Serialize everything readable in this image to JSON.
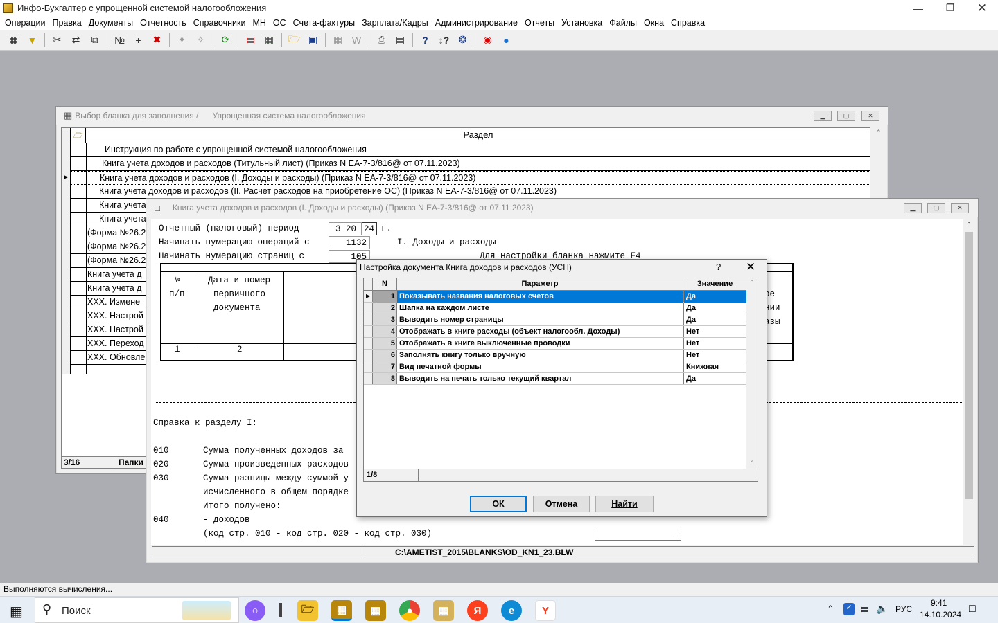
{
  "app": {
    "title": "Инфо-Бухгалтер с упрощенной системой налогообложения"
  },
  "menu": [
    "Операции",
    "Правка",
    "Документы",
    "Отчетность",
    "Справочники",
    "МН",
    "ОС",
    "Счета-фактуры",
    "Зарплата/Кадры",
    "Администрирование",
    "Отчеты",
    "Установка",
    "Файлы",
    "Окна",
    "Справка"
  ],
  "window1": {
    "title_part1": "Выбор бланка для заполнения /",
    "title_part2": "Упрощенная система налогообложения",
    "column_header": "Раздел",
    "rows": [
      "Инструкция по работе с упрощенной системой налогообложения",
      "Книга учета доходов и расходов (Титульный лист) (Приказ N ЕА-7-3/816@ от 07.11.2023)",
      "Книга учета доходов и расходов (I. Доходы и расходы) (Приказ N ЕА-7-3/816@ от 07.11.2023)",
      "Книга учета доходов и расходов (II. Расчет расходов на приобретение ОС) (Приказ N ЕА-7-3/816@ от 07.11.2023)",
      "Книга учета",
      "Книга учета",
      "(Форма №26.2",
      "(Форма №26.2",
      "(Форма №26.2",
      "Книга учета д",
      "Книга учета д",
      "XXX.  Измене",
      "XXX.  Настрой",
      "XXX.  Настрой",
      "XXX.  Переход",
      "XXX. Обновлен"
    ],
    "status_count": "3/16",
    "status_folder": "Папки"
  },
  "window2": {
    "title": "Книга учета доходов и расходов (I. Доходы и расходы) (Приказ N ЕА-7-3/816@ от 07.11.2023)",
    "period_label": "Отчетный (налоговый) период",
    "period_q": "3",
    "period_y1": "20",
    "period_y2": "24",
    "period_suffix": "г.",
    "ops_label": "Начинать нумерацию операций с",
    "ops_value": "1132",
    "section_title": "I. Доходы и расходы",
    "pages_label": "Начинать нумерацию страниц с",
    "pages_value": "105",
    "f4_hint": "Для настройки бланка нажмите F4",
    "table_h1a": "№",
    "table_h1b": "п/п",
    "table_h2a": "Дата и номер",
    "table_h2b": "первичного",
    "table_h2c": "документа",
    "table_frag1": "ре",
    "table_frag2": "нии",
    "table_frag3": "азы",
    "table_num1": "1",
    "table_num2": "2",
    "ref_title": "Справка к разделу I:",
    "ref_010_code": "010",
    "ref_010_text": "Сумма полученных доходов за",
    "ref_020_code": "020",
    "ref_020_text": "Сумма произведенных расходов",
    "ref_030_code": "030",
    "ref_030_text": "Сумма разницы между суммой у",
    "ref_030b_text": "исчисленного в общем порядке",
    "ref_total": "Итого получено:",
    "ref_040_code": "040",
    "ref_040_text": "- доходов",
    "ref_040b_text": "(код стр. 010 - код стр. 020 - код стр. 030)",
    "input_dash": "-",
    "path": "C:\\AMETIST_2015\\BLANKS\\OD_KN1_23.BLW"
  },
  "dialog": {
    "title": "Настройка документа Книга доходов и расходов (УСН)",
    "help": "?",
    "col_n": "N",
    "col_param": "Параметр",
    "col_value": "Значение",
    "rows": [
      {
        "n": "1",
        "param": "Показывать названия налоговых счетов",
        "value": "Да"
      },
      {
        "n": "2",
        "param": "Шапка на каждом листе",
        "value": "Да"
      },
      {
        "n": "3",
        "param": "Выводить номер страницы",
        "value": "Да"
      },
      {
        "n": "4",
        "param": "Отображать в книге расходы (объект налогообл. Доходы)",
        "value": "Нет"
      },
      {
        "n": "5",
        "param": "Отображать в книге выключенные проводки",
        "value": "Нет"
      },
      {
        "n": "6",
        "param": "Заполнять книгу только вручную",
        "value": "Нет"
      },
      {
        "n": "7",
        "param": "Вид печатной формы",
        "value": "Книжная"
      },
      {
        "n": "8",
        "param": "Выводить на печать только текущий квартал",
        "value": "Да"
      }
    ],
    "counter": "1/8",
    "ok": "ОК",
    "cancel": "Отмена",
    "find": "Найти"
  },
  "status": {
    "text": "Выполняются вычисления..."
  },
  "taskbar": {
    "search_placeholder": "Поиск",
    "lang": "РУС",
    "time": "9:41",
    "date": "14.10.2024"
  },
  "colors": {
    "selection": "#0078d7",
    "titlebar": "#ffffff",
    "desktop": "#abadb3"
  }
}
